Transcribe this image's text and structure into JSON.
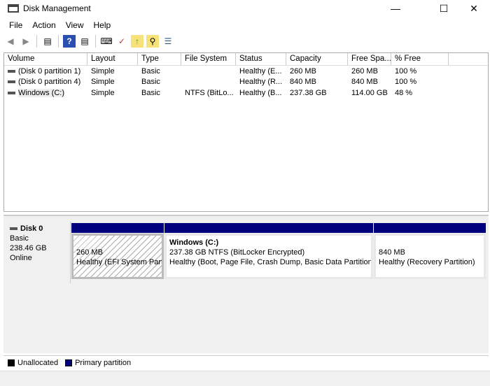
{
  "window": {
    "title": "Disk Management"
  },
  "menu": [
    "File",
    "Action",
    "View",
    "Help"
  ],
  "columns": [
    "Volume",
    "Layout",
    "Type",
    "File System",
    "Status",
    "Capacity",
    "Free Spa...",
    "% Free"
  ],
  "rows": [
    [
      "(Disk 0 partition 1)",
      "Simple",
      "Basic",
      "",
      "Healthy (E...",
      "260 MB",
      "260 MB",
      "100 %"
    ],
    [
      "(Disk 0 partition 4)",
      "Simple",
      "Basic",
      "",
      "Healthy (R...",
      "840 MB",
      "840 MB",
      "100 %"
    ],
    [
      "Windows (C:)",
      "Simple",
      "Basic",
      "NTFS (BitLo...",
      "Healthy (B...",
      "237.38 GB",
      "114.00 GB",
      "48 %"
    ]
  ],
  "disk": {
    "name": "Disk 0",
    "type": "Basic",
    "size": "238.46 GB",
    "state": "Online"
  },
  "partitions": [
    {
      "title": "",
      "size": "260 MB",
      "status": "Healthy (EFI System Part"
    },
    {
      "title": "Windows  (C:)",
      "size": "237.38 GB NTFS (BitLocker Encrypted)",
      "status": "Healthy (Boot, Page File, Crash Dump, Basic Data Partition"
    },
    {
      "title": "",
      "size": "840 MB",
      "status": "Healthy (Recovery Partition)"
    }
  ],
  "legend": {
    "unallocated": "Unallocated",
    "primary": "Primary partition"
  }
}
